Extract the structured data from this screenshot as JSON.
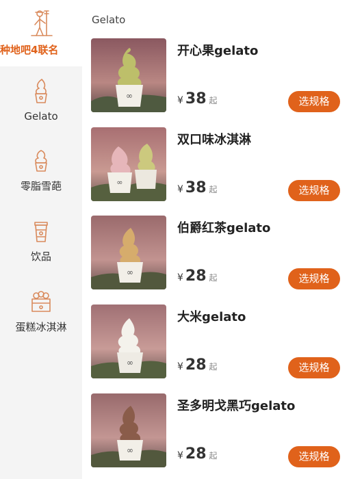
{
  "sidebar": {
    "top": {
      "label": "种地吧4联名",
      "icon": "farmer-icon"
    },
    "items": [
      {
        "label": "Gelato",
        "icon": "gelato-icon"
      },
      {
        "label": "零脂雪葩",
        "icon": "sorbet-icon"
      },
      {
        "label": "饮品",
        "icon": "drink-cup-icon"
      },
      {
        "label": "蛋糕冰淇淋",
        "icon": "cake-icon"
      }
    ]
  },
  "main": {
    "category_title": "Gelato",
    "products": [
      {
        "name": "开心果gelato",
        "currency": "¥",
        "price": "38",
        "suffix": "起",
        "button": "选规格"
      },
      {
        "name": "双口味冰淇淋",
        "currency": "¥",
        "price": "38",
        "suffix": "起",
        "button": "选规格"
      },
      {
        "name": "伯爵红茶gelato",
        "currency": "¥",
        "price": "28",
        "suffix": "起",
        "button": "选规格"
      },
      {
        "name": "大米gelato",
        "currency": "¥",
        "price": "28",
        "suffix": "起",
        "button": "选规格"
      },
      {
        "name": "圣多明戈黑巧gelato",
        "currency": "¥",
        "price": "28",
        "suffix": "起",
        "button": "选规格"
      }
    ]
  },
  "colors": {
    "accent": "#e0621b",
    "sidebar_bg": "#f4f4f4",
    "icon_line": "#d98a5c"
  }
}
